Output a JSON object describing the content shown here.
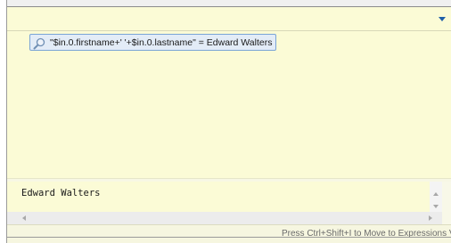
{
  "inspect_popup": {
    "toolbar": {
      "menu_icon": "chevron-down-icon"
    },
    "tree": {
      "items": [
        {
          "icon": "search-icon",
          "label": "\"$in.0.firstname+' '+$in.0.lastname\" = Edward Walters"
        }
      ]
    },
    "details": {
      "value": "Edward Walters"
    },
    "statusbar": {
      "hint": "Press Ctrl+Shift+I to Move to Expressions View"
    },
    "colors": {
      "background": "#fbfbd6",
      "selection": "#e3ecf7",
      "selection_border": "#7aa4d6",
      "accent": "#1f5fa8"
    }
  }
}
